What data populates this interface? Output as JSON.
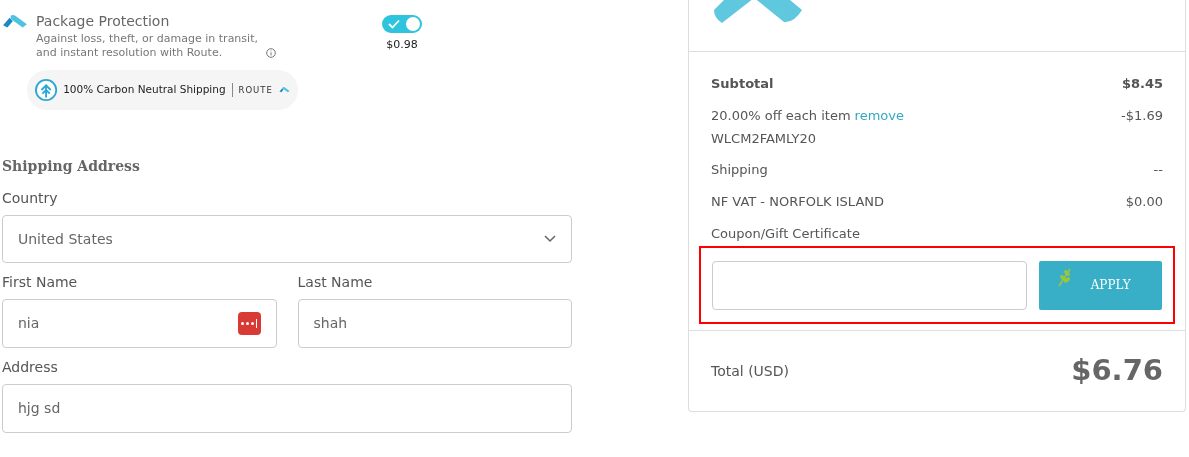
{
  "protection": {
    "title": "Package Protection",
    "description": "Against loss, theft, or damage in transit, and instant resolution with Route.",
    "on": true,
    "price": "$0.98",
    "badge": "100% Carbon Neutral Shipping",
    "brand": "ROUTE"
  },
  "shipping_address": {
    "heading": "Shipping Address",
    "rows": [
      {
        "fields": [
          {
            "label": "Country",
            "value": "United States",
            "kind": "select"
          }
        ]
      },
      {
        "fields": [
          {
            "label": "First Name",
            "value": "nia",
            "kind": "text",
            "autofill": true
          },
          {
            "label": "Last Name",
            "value": "shah",
            "kind": "text",
            "autofill": false
          }
        ]
      },
      {
        "fields": [
          {
            "label": "Address",
            "value": "hjg sd",
            "kind": "text",
            "autofill": false
          }
        ]
      }
    ]
  },
  "summary": {
    "lines": [
      {
        "kind": "subtotal",
        "label": "Subtotal",
        "value": "$8.45"
      },
      {
        "kind": "discount",
        "label": "20.00% off each item",
        "link": "remove",
        "code": "WLCM2FAMLY20",
        "value": "-$1.69"
      },
      {
        "kind": "line",
        "label": "Shipping",
        "value": "--"
      },
      {
        "kind": "line",
        "label": "NF VAT - NORFOLK ISLAND",
        "value": "$0.00"
      }
    ],
    "coupon": {
      "label": "Coupon/Gift Certificate",
      "button": "APPLY",
      "highlighted": true
    },
    "total": {
      "label": "Total (USD)",
      "value": "$6.76"
    }
  }
}
